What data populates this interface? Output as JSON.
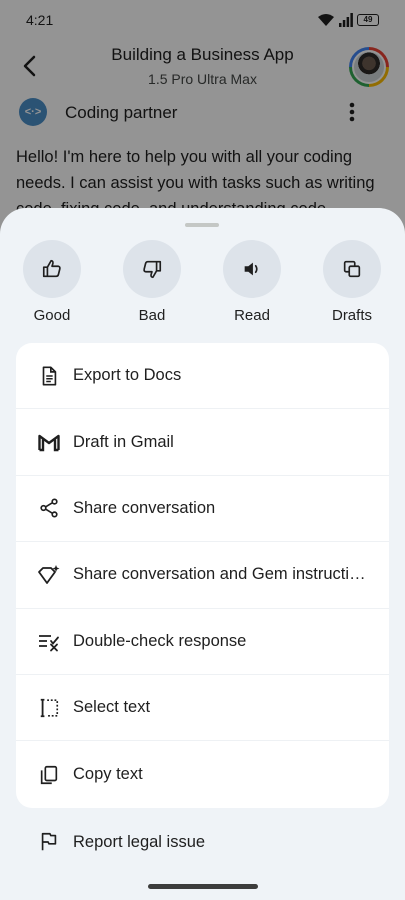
{
  "status_bar": {
    "time": "4:21",
    "battery": "49"
  },
  "header": {
    "title": "Building a Business App",
    "subtitle": "1.5 Pro Ultra Max"
  },
  "gem": {
    "icon_glyph": "<·>",
    "name": "Coding partner"
  },
  "message": "Hello! I'm here to help you with all your coding needs. I can assist you with tasks such as writing code, fixing code, and understanding code.",
  "sheet": {
    "quick_actions": [
      {
        "label": "Good",
        "icon": "thumbs-up-icon"
      },
      {
        "label": "Bad",
        "icon": "thumbs-down-icon"
      },
      {
        "label": "Read",
        "icon": "speaker-icon"
      },
      {
        "label": "Drafts",
        "icon": "drafts-icon"
      }
    ],
    "menu_items": [
      {
        "label": "Export to Docs",
        "icon": "docs-icon"
      },
      {
        "label": "Draft in Gmail",
        "icon": "gmail-icon"
      },
      {
        "label": "Share conversation",
        "icon": "share-icon"
      },
      {
        "label": "Share conversation and Gem instructions",
        "icon": "gem-share-icon"
      },
      {
        "label": "Double-check response",
        "icon": "double-check-icon"
      },
      {
        "label": "Select text",
        "icon": "select-text-icon"
      },
      {
        "label": "Copy text",
        "icon": "copy-icon"
      }
    ],
    "report": {
      "label": "Report legal issue",
      "icon": "flag-icon"
    }
  },
  "colors": {
    "sheet_bg": "#eff3f7",
    "quick_action_bg": "#dde3ea",
    "card_bg": "#ffffff",
    "gem_icon_bg": "#4a8fc9"
  }
}
